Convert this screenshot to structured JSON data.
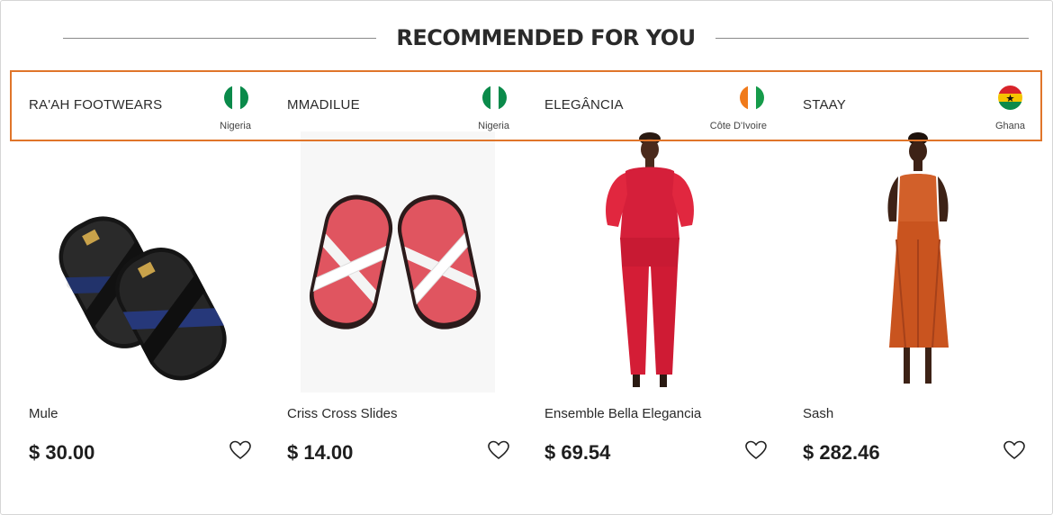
{
  "section": {
    "title": "RECOMMENDED FOR YOU"
  },
  "colors": {
    "accent_highlight": "#e0752a",
    "text": "#1f1f1f"
  },
  "products": [
    {
      "vendor": "RA'AH FOOTWEARS",
      "country": "Nigeria",
      "flag_icon": "nigeria-flag-icon",
      "name": "Mule",
      "price": "$ 30.00"
    },
    {
      "vendor": "MMADILUE",
      "country": "Nigeria",
      "flag_icon": "nigeria-flag-icon",
      "name": "Criss Cross Slides",
      "price": "$ 14.00"
    },
    {
      "vendor": "ELEGÂNCIA",
      "country": "Côte D'Ivoire",
      "flag_icon": "cote-divoire-flag-icon",
      "name": "Ensemble Bella Elegancia",
      "price": "$ 69.54"
    },
    {
      "vendor": "STAAY",
      "country": "Ghana",
      "flag_icon": "ghana-flag-icon",
      "name": "Sash",
      "price": "$ 282.46"
    }
  ]
}
